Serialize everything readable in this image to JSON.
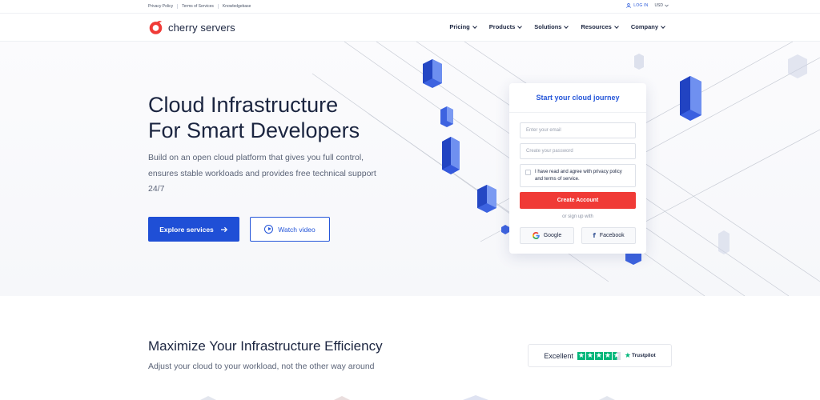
{
  "topbar": {
    "links": [
      "Privacy Policy",
      "Terms of Services",
      "Knowledgebase"
    ],
    "login_label": "LOG IN",
    "currency": "USD"
  },
  "brand": {
    "name": "cherry servers",
    "accent": "#f03a36"
  },
  "nav": {
    "items": [
      "Pricing",
      "Products",
      "Solutions",
      "Resources",
      "Company"
    ]
  },
  "hero": {
    "title_line1": "Cloud Infrastructure",
    "title_line2": "For Smart Developers",
    "description": "Build on an open cloud platform that gives you full control, ensures stable workloads and provides free technical support 24/7",
    "primary_button": "Explore services",
    "secondary_button": "Watch video"
  },
  "signup": {
    "title": "Start your cloud journey",
    "email_placeholder": "Enter your email",
    "password_placeholder": "Create your password",
    "agree_text": "I have read and agree with privacy policy and terms of service.",
    "create_button": "Create Account",
    "or_text": "or sign up with",
    "google_label": "Google",
    "facebook_label": "Facebook"
  },
  "section2": {
    "title": "Maximize Your Infrastructure Efficiency",
    "subtitle": "Adjust your cloud to your workload, not the other way around"
  },
  "trustpilot": {
    "label": "Excellent",
    "rating_stars": 4.5,
    "brand": "Trustpilot"
  },
  "colors": {
    "primary": "#1f4fd6",
    "link": "#2556d9",
    "cta": "#f03a36",
    "trust_green": "#00b67a"
  }
}
